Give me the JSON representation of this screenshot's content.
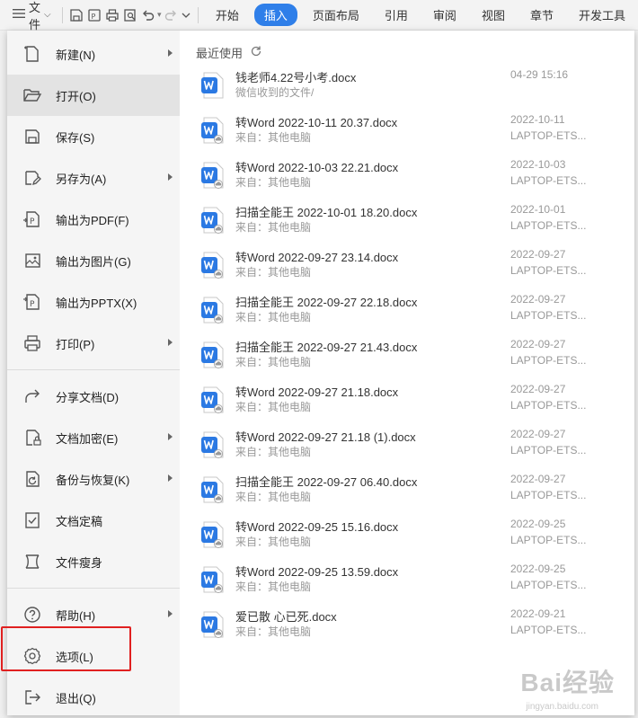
{
  "toolbar": {
    "menu_label": "文件",
    "tabs": [
      "开始",
      "插入",
      "页面布局",
      "引用",
      "审阅",
      "视图",
      "章节",
      "开发工具"
    ],
    "active_tab": 1
  },
  "sidebar": {
    "items": [
      {
        "label": "新建(N)",
        "icon": "new-file-icon",
        "arrow": true
      },
      {
        "label": "打开(O)",
        "icon": "folder-open-icon",
        "arrow": false
      },
      {
        "label": "保存(S)",
        "icon": "save-icon",
        "arrow": false
      },
      {
        "label": "另存为(A)",
        "icon": "save-as-icon",
        "arrow": true
      },
      {
        "label": "输出为PDF(F)",
        "icon": "pdf-export-icon",
        "arrow": false
      },
      {
        "label": "输出为图片(G)",
        "icon": "image-export-icon",
        "arrow": false
      },
      {
        "label": "输出为PPTX(X)",
        "icon": "pptx-export-icon",
        "arrow": false
      },
      {
        "label": "打印(P)",
        "icon": "print-icon",
        "arrow": true
      },
      {
        "label": "分享文档(D)",
        "icon": "share-icon",
        "arrow": false
      },
      {
        "label": "文档加密(E)",
        "icon": "encrypt-icon",
        "arrow": true
      },
      {
        "label": "备份与恢复(K)",
        "icon": "backup-icon",
        "arrow": true
      },
      {
        "label": "文档定稿",
        "icon": "finalize-icon",
        "arrow": false
      },
      {
        "label": "文件瘦身",
        "icon": "slim-icon",
        "arrow": false
      },
      {
        "label": "帮助(H)",
        "icon": "help-icon",
        "arrow": true
      },
      {
        "label": "选项(L)",
        "icon": "gear-icon",
        "arrow": false
      },
      {
        "label": "退出(Q)",
        "icon": "exit-icon",
        "arrow": false
      }
    ]
  },
  "recent": {
    "title": "最近使用",
    "files": [
      {
        "name": "钱老师4.22号小考.docx",
        "source": "微信收到的文件/",
        "date": "04-29 15:16",
        "device": ""
      },
      {
        "name": "转Word 2022-10-11 20.37.docx",
        "source": "来自：其他电脑",
        "date": "2022-10-11",
        "device": "LAPTOP-ETS..."
      },
      {
        "name": "转Word 2022-10-03 22.21.docx",
        "source": "来自：其他电脑",
        "date": "2022-10-03",
        "device": "LAPTOP-ETS..."
      },
      {
        "name": "扫描全能王 2022-10-01 18.20.docx",
        "source": "来自：其他电脑",
        "date": "2022-10-01",
        "device": "LAPTOP-ETS..."
      },
      {
        "name": "转Word 2022-09-27 23.14.docx",
        "source": "来自：其他电脑",
        "date": "2022-09-27",
        "device": "LAPTOP-ETS..."
      },
      {
        "name": "扫描全能王 2022-09-27 22.18.docx",
        "source": "来自：其他电脑",
        "date": "2022-09-27",
        "device": "LAPTOP-ETS..."
      },
      {
        "name": "扫描全能王 2022-09-27 21.43.docx",
        "source": "来自：其他电脑",
        "date": "2022-09-27",
        "device": "LAPTOP-ETS..."
      },
      {
        "name": "转Word 2022-09-27 21.18.docx",
        "source": "来自：其他电脑",
        "date": "2022-09-27",
        "device": "LAPTOP-ETS..."
      },
      {
        "name": "转Word 2022-09-27 21.18 (1).docx",
        "source": "来自：其他电脑",
        "date": "2022-09-27",
        "device": "LAPTOP-ETS..."
      },
      {
        "name": "扫描全能王 2022-09-27 06.40.docx",
        "source": "来自：其他电脑",
        "date": "2022-09-27",
        "device": "LAPTOP-ETS..."
      },
      {
        "name": "转Word 2022-09-25 15.16.docx",
        "source": "来自：其他电脑",
        "date": "2022-09-25",
        "device": "LAPTOP-ETS..."
      },
      {
        "name": "转Word 2022-09-25 13.59.docx",
        "source": "来自：其他电脑",
        "date": "2022-09-25",
        "device": "LAPTOP-ETS..."
      },
      {
        "name": "爱已散 心已死.docx",
        "source": "来自：其他电脑",
        "date": "2022-09-21",
        "device": "LAPTOP-ETS..."
      }
    ]
  },
  "watermark": {
    "text": "Bai经验",
    "sub": "jingyan.baidu.com"
  },
  "colors": {
    "accent": "#2f7fe9",
    "highlight": "#e02020",
    "word_icon": "#2b79e3"
  }
}
